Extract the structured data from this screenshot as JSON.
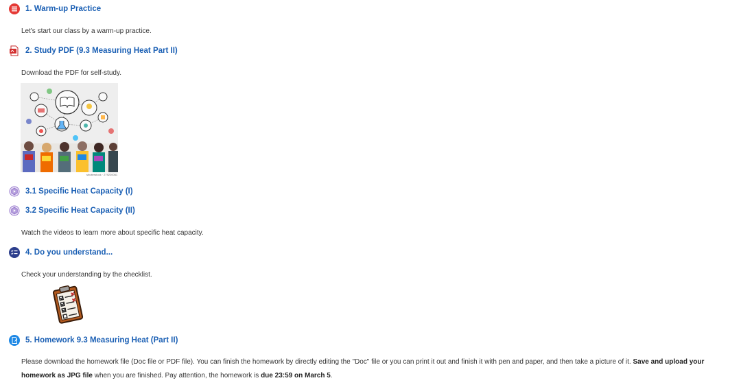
{
  "activities": [
    {
      "title": "1. Warm-up Practice",
      "icon": "quiz-icon",
      "description": "Let's start our class by a warm-up practice."
    },
    {
      "title": "2. Study PDF (9.3 Measuring Heat Part II)",
      "icon": "pdf-icon",
      "description": "Download the PDF for self-study."
    },
    {
      "title": "3.1 Specific Heat Capacity (I)",
      "icon": "video-icon"
    },
    {
      "title": "3.2 Specific Heat Capacity (II)",
      "icon": "video-icon",
      "description": "Watch the videos to learn more about specific heat capacity."
    },
    {
      "title": "4. Do you understand...",
      "icon": "checklist-icon",
      "description": "Check your understanding by the checklist."
    },
    {
      "title": "5. Homework 9.3 Measuring Heat (Part II)",
      "icon": "assignment-icon",
      "description_part1": "Please download the homework file (Doc file or PDF file). You can finish the homework by directly editing the \"Doc\" file or you can print it out and finish it with pen and paper, and then take a picture of it. ",
      "description_bold1": "Save and upload your homework as JPG file",
      "description_part2": " when you are finished. Pay attention, the homework is ",
      "description_bold2": "due 23:59 on March 5",
      "description_part3": "."
    }
  ],
  "image_caption": "shutterstock · 279220061",
  "colors": {
    "link": "#1a5fb4",
    "quiz_red": "#e53935",
    "video_purple": "#8e7cc3",
    "checklist_navy": "#2c3e8c",
    "assign_blue": "#1e88e5"
  }
}
